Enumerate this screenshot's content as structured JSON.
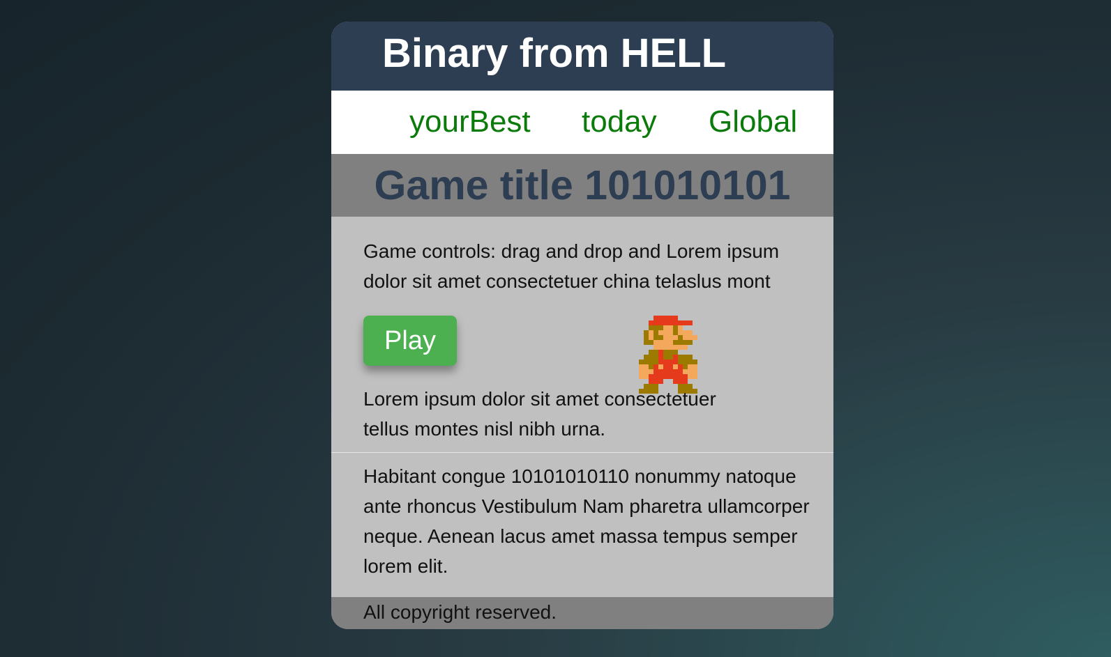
{
  "header": {
    "title": "Binary from HELL"
  },
  "nav": {
    "links": [
      {
        "label": "yourBest"
      },
      {
        "label": "today"
      },
      {
        "label": "Global"
      }
    ],
    "link_color": "#0a7a0a"
  },
  "game": {
    "title": "Game title 101010101",
    "controls_text": "Game controls: drag and drop and Lorem ipsum dolor sit amet consectetuer china telaslus mont",
    "play_label": "Play",
    "sprite_icon": "mario-sprite-icon",
    "below_text": "Lorem ipsum dolor sit amet consectetuer tellus montes nisl nibh urna."
  },
  "info": {
    "text": "Habitant congue 10101010110 nonummy natoque ante rhoncus Vestibulum Nam pharetra ullamcorper neque. Aenean lacus amet massa tempus semper lorem elit."
  },
  "footer": {
    "copyright": "All copyright reserved."
  },
  "colors": {
    "header_bg": "#2d3d52",
    "title_bar_bg": "#808080",
    "content_bg": "#c0c0c0",
    "play_button": "#4caf50"
  }
}
